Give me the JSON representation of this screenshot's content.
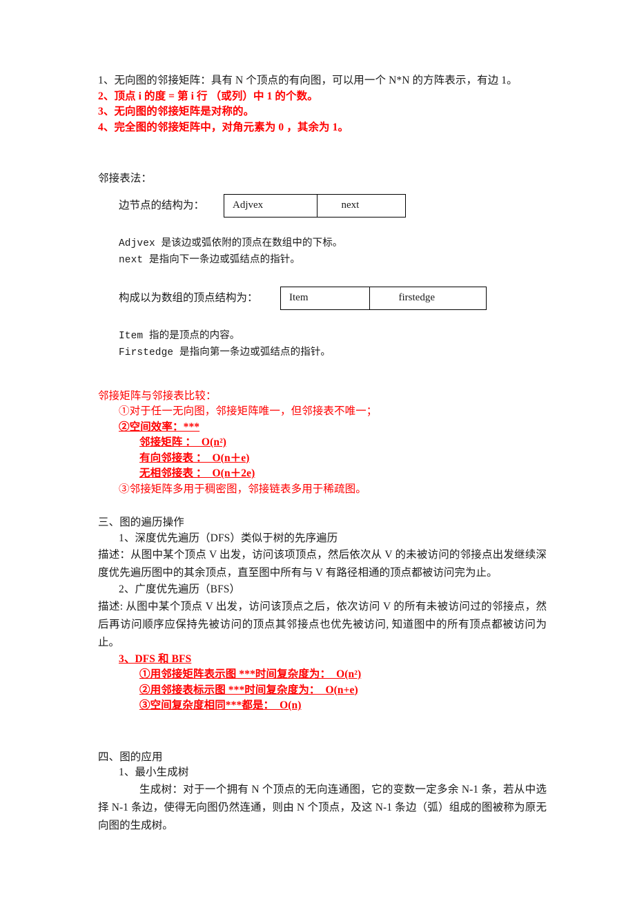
{
  "document": {
    "section_matrix_props": {
      "items": [
        {
          "text": "1、无向图的邻接矩阵：具有 N 个顶点的有向图，可以用一个 N*N 的方阵表示，有边 1。",
          "color": "#1a1a1a",
          "bold": false
        },
        {
          "text": "2、顶点 i 的度 = 第 i 行 （或列）中 1 的个数。",
          "color": "#ff0000",
          "bold": true
        },
        {
          "text": "3、无向图的邻接矩阵是对称的。",
          "color": "#ff0000",
          "bold": true
        },
        {
          "text": "4、完全图的邻接矩阵中，对角元素为 0 ，其余为 1。",
          "color": "#ff0000",
          "bold": true
        }
      ]
    },
    "section_adjlist": {
      "heading": "邻接表法：",
      "edge_node_label": "边节点的结构为：",
      "edge_node_table": {
        "cells": [
          "Adjvex",
          "next"
        ]
      },
      "edge_node_notes": [
        "Adjvex 是该边或弧依附的顶点在数组中的下标。",
        "next 是指向下一条边或弧结点的指针。"
      ],
      "vertex_node_label": "构成以为数组的顶点结构为：",
      "vertex_node_table": {
        "cells": [
          "Item",
          "firstedge"
        ]
      },
      "vertex_node_notes": [
        "Item 指的是顶点的内容。",
        "Firstedge 是指向第一条边或弧结点的指针。"
      ]
    },
    "section_compare": {
      "heading": "邻接矩阵与邻接表比较：",
      "item1": "①对于任一无向图，邻接矩阵唯一，但邻接表不唯一；",
      "item2_label": "②空间效率：***",
      "complexities": [
        "邻接矩阵 ：  O(n²)",
        "有向邻接表 ：  O(n＋e)",
        "无相邻接表 ：  O(n＋2e)"
      ],
      "item3": "③邻接矩阵多用于稠密图，邻接链表多用于稀疏图。"
    },
    "section_traversal": {
      "heading": "三、图的遍历操作",
      "dfs_title": "1、深度优先遍历（DFS）类似于树的先序遍历",
      "dfs_desc": "描述：从图中某个顶点 V 出发，访问该项顶点，然后依次从 V 的未被访问的邻接点出发继续深度优先遍历图中的其余顶点，直至图中所有与 V 有路径相通的顶点都被访问完为止。",
      "bfs_title": "2、广度优先遍历（BFS）",
      "bfs_desc": "描述: 从图中某个顶点 V 出发，访问该顶点之后，依次访问 V 的所有未被访问过的邻接点，然后再访问顺序应保持先被访问的顶点其邻接点也优先被访问, 知道图中的所有顶点都被访问为止。",
      "dfs_bfs_heading": "3、DFS 和 BFS",
      "dfs_bfs_items": [
        "①用邻接矩阵表示图 ***时间复杂度为：  O(n²)",
        "②用邻接表标示图 ***时间复杂度为：  O(n+e)",
        "③空间复杂度相同***都是：  O(n)"
      ]
    },
    "section_application": {
      "heading": "四、图的应用",
      "mst_title": "1、最小生成树",
      "mst_desc": "生成树：对于一个拥有 N 个顶点的无向连通图，它的变数一定多余 N-1 条，若从中选择 N-1 条边，使得无向图仍然连通，则由 N 个顶点，及这 N-1 条边（弧）组成的图被称为原无向图的生成树。"
    }
  }
}
